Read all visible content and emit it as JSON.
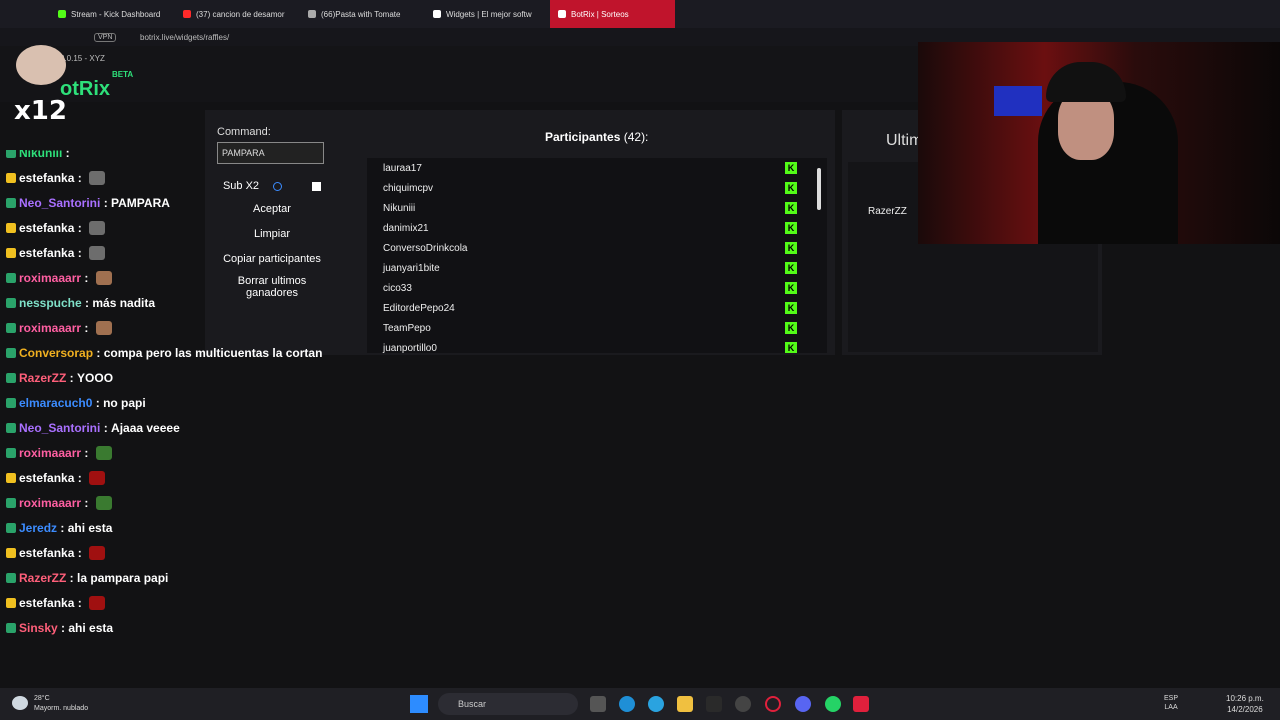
{
  "browser": {
    "tabs": [
      {
        "title": "Stream - Kick Dashboard",
        "color": "#53fc18"
      },
      {
        "title": "(37) cancion de desamor",
        "color": "#ff2a2a"
      },
      {
        "title": "(66)Pasta with Tomate",
        "color": "#aaaaaa"
      },
      {
        "title": "Widgets | El mejor softw",
        "color": "#ffffff"
      },
      {
        "title": "BotRix | Sorteos",
        "color": "#ffffff",
        "active": true
      }
    ],
    "url": "botrix.live/widgets/raffles/",
    "vpn_label": "VPN"
  },
  "app": {
    "version": "2.0.15 - XYZ",
    "logo": "otRix",
    "logo_tag": "BETA",
    "overlay_multiplier": "x12"
  },
  "raffle": {
    "command_label": "Command:",
    "command_value": "PAMPARA",
    "sub_label": "Sub X2",
    "accept_label": "Aceptar",
    "clear_label": "Limpiar",
    "copy_label": "Copiar participantes",
    "delete_winners_label": "Borrar ultimos ganadores",
    "participants_label": "Participantes",
    "participants_count": "(42):",
    "participants": [
      "lauraa17",
      "chiquimcpv",
      "Nikuniii",
      "danimix21",
      "ConversoDrinkcola",
      "juanyari1bite",
      "cico33",
      "EditordePepo24",
      "TeamPepo",
      "juanportillo0"
    ],
    "platform_badge": "K",
    "winners_title": "Ultim",
    "winners": [
      "RazerZZ"
    ]
  },
  "chat": {
    "messages": [
      {
        "user": "Nikuniii",
        "text": "",
        "color": "#2ee07a",
        "top": 0
      },
      {
        "user": "estefanka",
        "text": "",
        "color": "#ffffff",
        "emote": "#6d6d6d"
      },
      {
        "user": "Neo_Santorini",
        "text": "PAMPARA",
        "color": "#a970ff"
      },
      {
        "user": "estefanka",
        "text": "",
        "color": "#ffffff",
        "emote": "#6d6d6d"
      },
      {
        "user": "estefanka",
        "text": "",
        "color": "#ffffff",
        "emote": "#6d6d6d"
      },
      {
        "user": "roximaaarr",
        "text": "",
        "color": "#ff5fa2",
        "emote": "#a07050"
      },
      {
        "user": "nesspuche",
        "text": "más nadita",
        "color": "#7fe0c8"
      },
      {
        "user": "roximaaarr",
        "text": "",
        "color": "#ff5fa2",
        "emote": "#a07050"
      },
      {
        "user": "Conversorap",
        "text": "compa pero las multicuentas la cortan",
        "color": "#f0b020"
      },
      {
        "user": "RazerZZ",
        "text": "YOOO",
        "color": "#ff5f7a"
      },
      {
        "user": "elmaracuch0",
        "text": "no papi",
        "color": "#3c8cff"
      },
      {
        "user": "Neo_Santorini",
        "text": "Ajaaa veeee",
        "color": "#a970ff"
      },
      {
        "user": "roximaaarr",
        "text": "",
        "color": "#ff5fa2",
        "emote": "#3a7a30"
      },
      {
        "user": "estefanka",
        "text": "",
        "color": "#ffffff",
        "emote": "#a01010"
      },
      {
        "user": "roximaaarr",
        "text": "",
        "color": "#ff5fa2",
        "emote": "#3a7a30"
      },
      {
        "user": "Jeredz",
        "text": "ahi esta",
        "color": "#3c8cff"
      },
      {
        "user": "estefanka",
        "text": "",
        "color": "#ffffff",
        "emote": "#a01010"
      },
      {
        "user": "RazerZZ",
        "text": "la pampara papi",
        "color": "#ff5f7a"
      },
      {
        "user": "estefanka",
        "text": "",
        "color": "#ffffff",
        "emote": "#a01010"
      },
      {
        "user": "Sinsky",
        "text": "ahi esta",
        "color": "#ff5f7a"
      }
    ]
  },
  "taskbar": {
    "temperature": "28°C",
    "weather": "Mayorm. nublado",
    "search_label": "Buscar",
    "lang": "ESP",
    "region": "LAA",
    "time": "10:26 p.m.",
    "date": "14/2/2026"
  }
}
